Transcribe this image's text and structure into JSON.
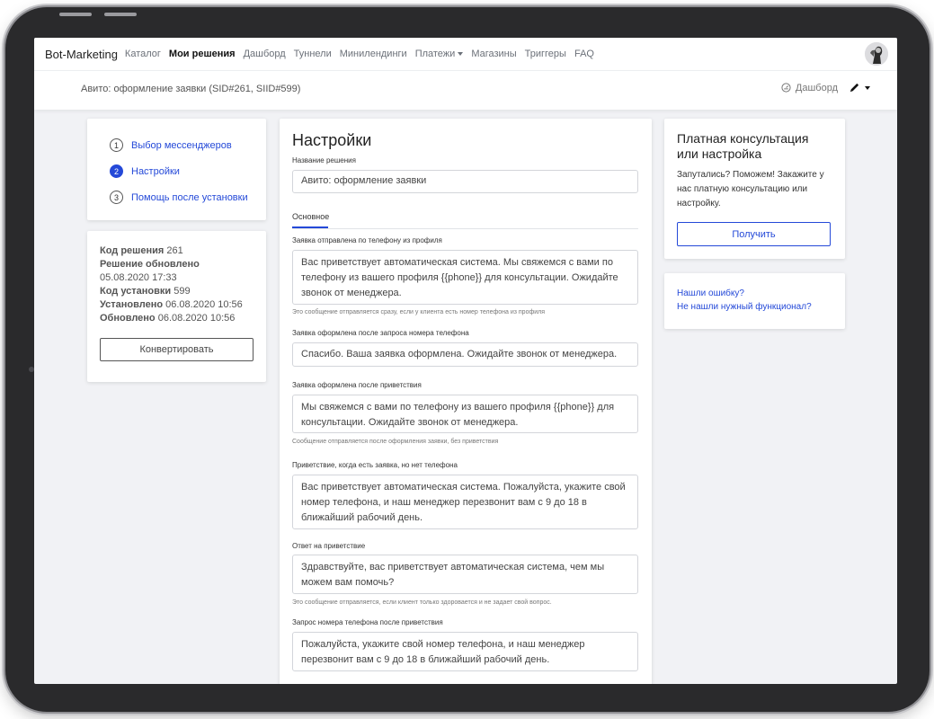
{
  "nav": {
    "brand": "Bot-Marketing",
    "items": [
      {
        "label": "Каталог",
        "active": false
      },
      {
        "label": "Мои решения",
        "active": true
      },
      {
        "label": "Дашборд",
        "active": false
      },
      {
        "label": "Туннели",
        "active": false
      },
      {
        "label": "Минилендинги",
        "active": false
      },
      {
        "label": "Платежи",
        "active": false,
        "dropdown": true
      },
      {
        "label": "Магазины",
        "active": false
      },
      {
        "label": "Триггеры",
        "active": false
      },
      {
        "label": "FAQ",
        "active": false
      }
    ]
  },
  "subheader": {
    "title": "Авито: оформление заявки (SID#261, SIID#599)",
    "dashboard_label": "Дашборд"
  },
  "steps": [
    {
      "num": "1",
      "label": "Выбор мессенджеров",
      "active": false
    },
    {
      "num": "2",
      "label": "Настройки",
      "active": true
    },
    {
      "num": "3",
      "label": "Помощь после установки",
      "active": false
    }
  ],
  "info": {
    "code_label": "Код решения",
    "code_value": "261",
    "updated_label": "Решение обновлено",
    "updated_value": "05.08.2020 17:33",
    "install_label": "Код установки",
    "install_value": "599",
    "installed_label": "Установлено",
    "installed_value": "06.08.2020 10:56",
    "refreshed_label": "Обновлено",
    "refreshed_value": "06.08.2020 10:56",
    "convert_button": "Конвертировать"
  },
  "settings": {
    "heading": "Настройки",
    "name_label": "Название решения",
    "name_value": "Авито: оформление заявки",
    "tab_label": "Основное",
    "fields": [
      {
        "label": "Заявка отправлена по телефону из профиля",
        "value": "Вас приветствует автоматическая система. Мы свяжемся с вами по телефону из вашего профиля {{phone}} для консультации. Ожидайте звонок от менеджера.",
        "hint": "Это сообщение отправляется сразу, если у клиента есть номер телефона из профиля"
      },
      {
        "label": "Заявка оформлена после запроса номера телефона",
        "value": "Спасибо. Ваша заявка оформлена. Ожидайте звонок от менеджера.",
        "hint": ""
      },
      {
        "label": "Заявка оформлена после приветствия",
        "value": "Мы свяжемся с вами по телефону из вашего профиля {{phone}} для консультации. Ожидайте звонок от менеджера.",
        "hint": "Сообщение отправляется после оформления заявки, без приветствия"
      },
      {
        "label": "Приветствие, когда есть заявка, но нет телефона",
        "value": "Вас приветствует автоматическая система. Пожалуйста, укажите свой номер телефона, и наш менеджер перезвонит вам с 9 до 18 в ближайший рабочий день.",
        "hint": ""
      },
      {
        "label": "Ответ на приветствие",
        "value": "Здравствуйте, вас приветствует автоматическая система, чем мы можем вам помочь?",
        "hint": "Это сообщение отправляется, если клиент только здоровается и не задает свой вопрос."
      },
      {
        "label": "Запрос номера телефона после приветствия",
        "value": "Пожалуйста, укажите свой номер телефона, и наш менеджер перезвонит вам с 9 до 18 в ближайший рабочий день.",
        "hint": ""
      }
    ]
  },
  "consult": {
    "title": "Платная консультация или настройка",
    "text": "Запутались? Поможем! Закажите у нас платную консультацию или настройку.",
    "button": "Получить"
  },
  "help_links": {
    "bug": "Нашли ошибку?",
    "feature": "Не нашли нужный функционал?"
  }
}
